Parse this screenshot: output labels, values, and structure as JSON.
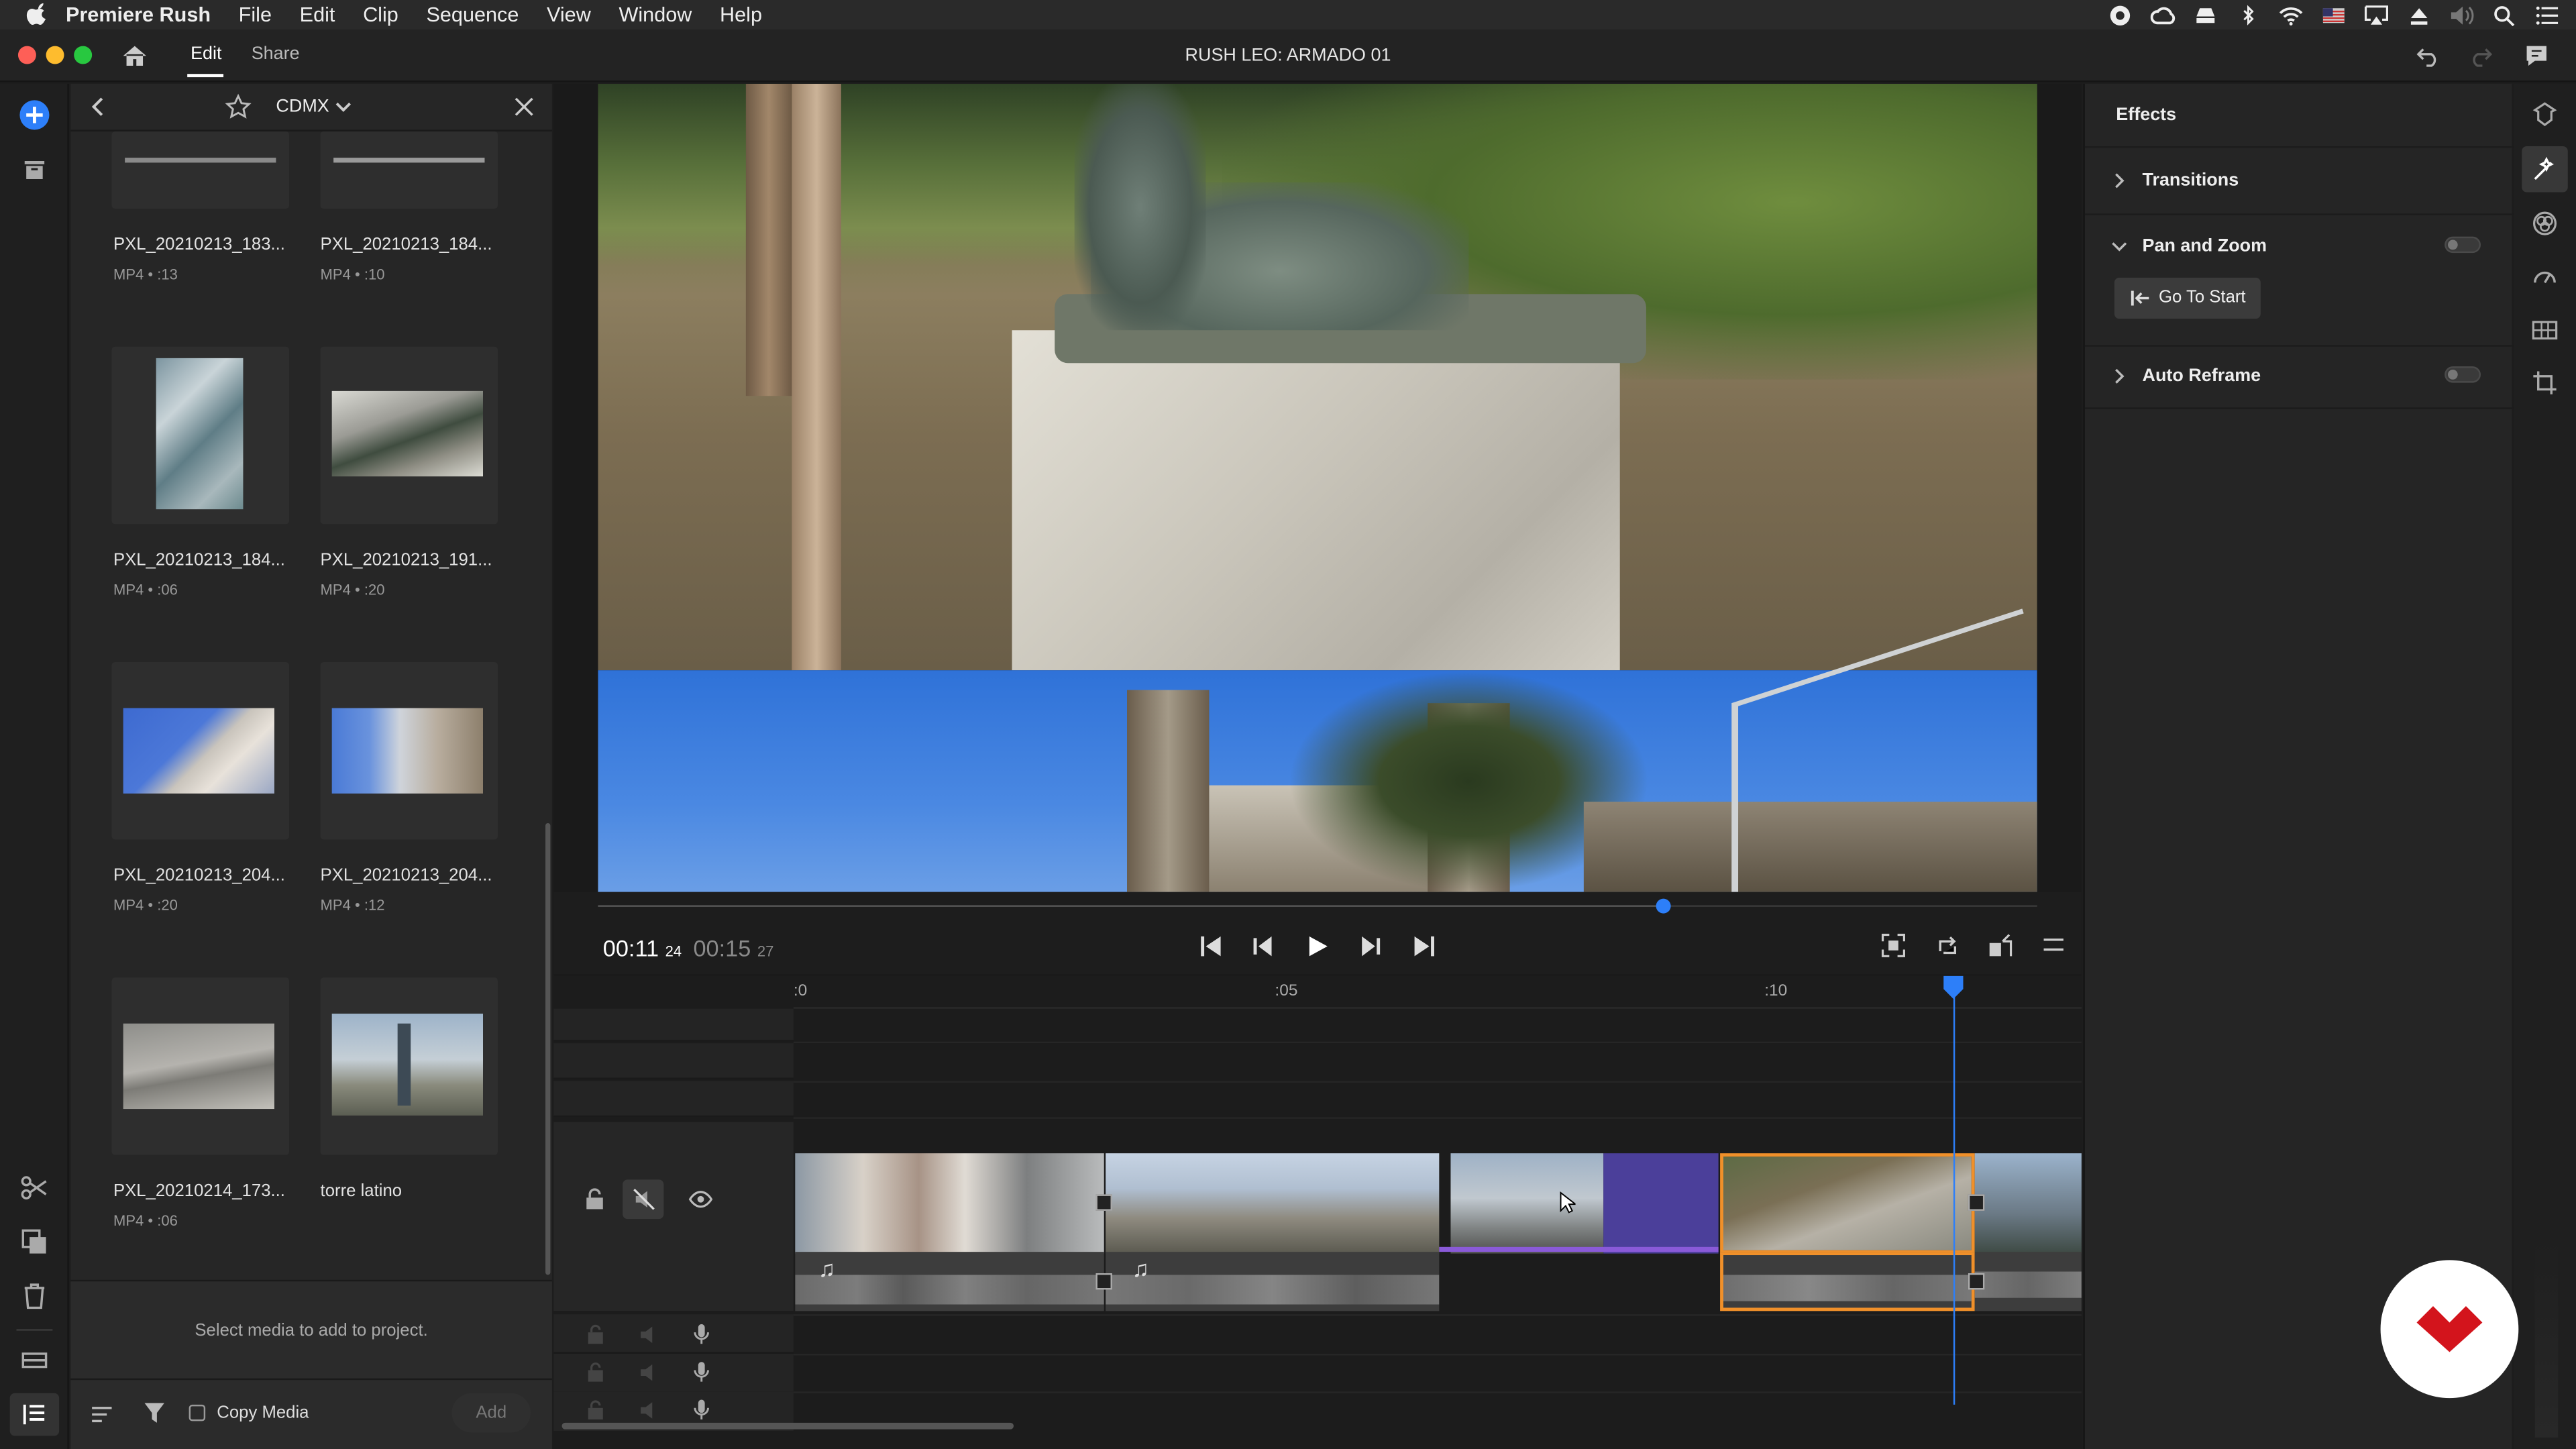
{
  "menubar": {
    "app": "Premiere Rush",
    "items": [
      "File",
      "Edit",
      "Clip",
      "Sequence",
      "View",
      "Window",
      "Help"
    ]
  },
  "titlebar": {
    "tabs": [
      "Edit",
      "Share"
    ],
    "title": "RUSH LEO: ARMADO 01"
  },
  "media": {
    "folder": "CDMX",
    "items": [
      {
        "name": "PXL_20210213_183...",
        "meta": "MP4 • :13"
      },
      {
        "name": "PXL_20210213_184...",
        "meta": "MP4 • :10"
      },
      {
        "name": "PXL_20210213_184...",
        "meta": "MP4 • :06"
      },
      {
        "name": "PXL_20210213_191...",
        "meta": "MP4 • :20"
      },
      {
        "name": "PXL_20210213_204...",
        "meta": "MP4 • :20"
      },
      {
        "name": "PXL_20210213_204...",
        "meta": "MP4 • :12"
      },
      {
        "name": "PXL_20210214_173...",
        "meta": "MP4 • :06"
      },
      {
        "name": "torre latino",
        "meta": ""
      }
    ],
    "hint": "Select media to add to project.",
    "copy_media": "Copy Media",
    "add": "Add"
  },
  "player": {
    "current": "00:11",
    "current_frames": "24",
    "duration": "00:15",
    "duration_frames": "27",
    "progress": 0.74
  },
  "timeline": {
    "ruler": [
      ":0",
      ":05",
      ":10"
    ],
    "playhead_seconds": 11.8
  },
  "effects": {
    "title": "Effects",
    "sections": [
      {
        "label": "Transitions",
        "expanded": false
      },
      {
        "label": "Pan and Zoom",
        "expanded": true
      },
      {
        "label": "Auto Reframe",
        "expanded": false
      }
    ],
    "go_to_start": "Go To Start",
    "pan_zoom_on": false,
    "auto_reframe_on": false
  },
  "colors": {
    "accent": "#2d7ff9",
    "selection": "#f0902a",
    "title_clip": "#4b3f9a",
    "brand": "#d3141c"
  }
}
